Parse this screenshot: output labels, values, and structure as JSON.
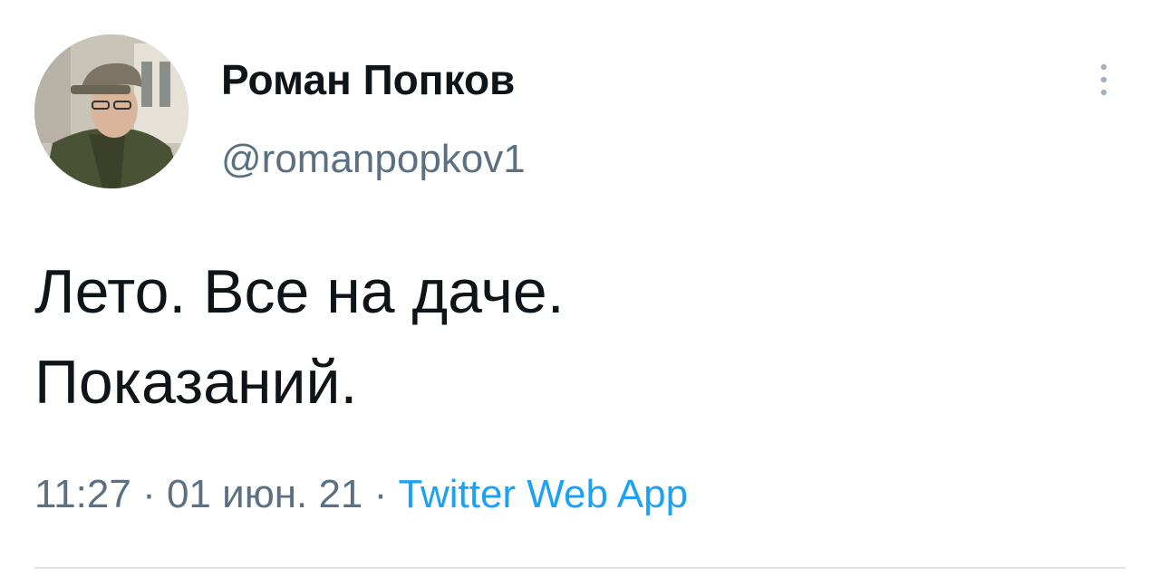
{
  "author": {
    "display_name": "Роман Попков",
    "handle": "@romanpopkov1",
    "avatar_icon": "user-avatar-photo"
  },
  "actions": {
    "more_icon": "vertical-ellipsis-icon"
  },
  "tweet": {
    "lines": [
      "Лето. Все на даче.",
      "Показаний."
    ]
  },
  "meta": {
    "time": "11:27",
    "separator": " · ",
    "date": "01 июн. 21",
    "source": "Twitter Web App"
  },
  "colors": {
    "text": "#0f1419",
    "secondary": "#5b7083",
    "link": "#1da1f2",
    "divider": "#dfe5ea"
  }
}
